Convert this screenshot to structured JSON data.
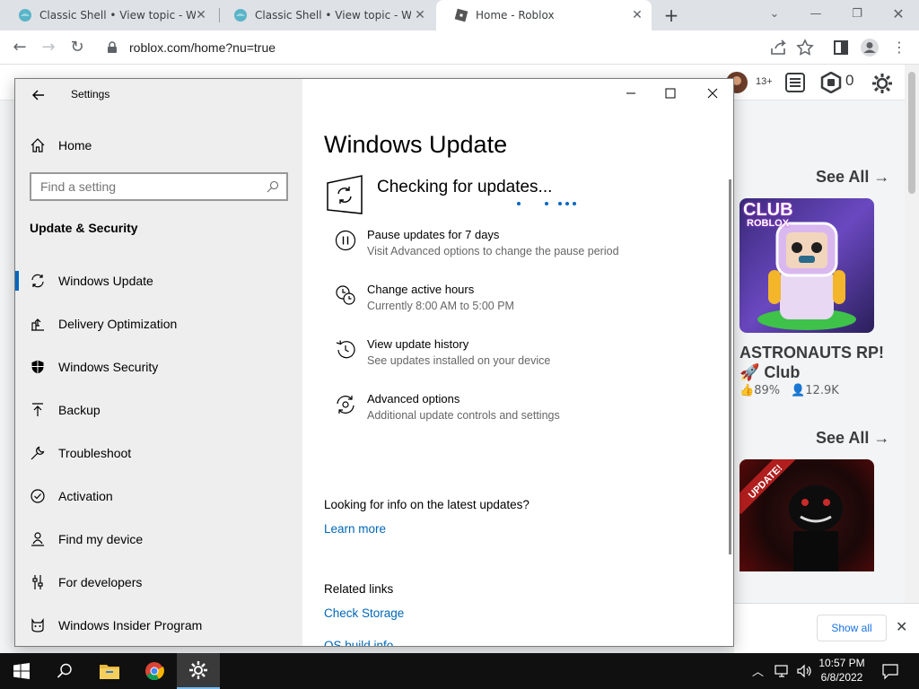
{
  "browser": {
    "tabs": [
      {
        "title": "Classic Shell • View topic - Windo",
        "active": false
      },
      {
        "title": "Classic Shell • View topic - Windo",
        "active": false
      },
      {
        "title": "Home - Roblox",
        "active": true
      }
    ],
    "url": "roblox.com/home?nu=true",
    "accent": "#1a73e8"
  },
  "roblox": {
    "notification_badge": "13+",
    "robux_count": "0",
    "see_all_1": "See All →",
    "see_all_2": "See All →",
    "game_title": "ASTRONAUTS RP! 🚀 Club",
    "game_like": "89%",
    "game_players": "12.9K",
    "thumb1_text_top": "CLUB",
    "thumb1_text_bottom": "ROBLOX",
    "thumb2_badge": "UPDATE!"
  },
  "downloads": {
    "show_all": "Show all"
  },
  "settings": {
    "window_title": "Settings",
    "home": "Home",
    "search_placeholder": "Find a setting",
    "section": "Update & Security",
    "nav": [
      {
        "label": "Windows Update",
        "icon": "sync-icon",
        "selected": true
      },
      {
        "label": "Delivery Optimization",
        "icon": "delivery-icon",
        "selected": false
      },
      {
        "label": "Windows Security",
        "icon": "shield-icon",
        "selected": false
      },
      {
        "label": "Backup",
        "icon": "backup-arrow-icon",
        "selected": false
      },
      {
        "label": "Troubleshoot",
        "icon": "wrench-icon",
        "selected": false
      },
      {
        "label": "Activation",
        "icon": "check-circle-icon",
        "selected": false
      },
      {
        "label": "Find my device",
        "icon": "person-pin-icon",
        "selected": false
      },
      {
        "label": "For developers",
        "icon": "developer-sliders-icon",
        "selected": false
      },
      {
        "label": "Windows Insider Program",
        "icon": "insider-cat-icon",
        "selected": false
      }
    ],
    "page_title": "Windows Update",
    "status": "Checking for updates...",
    "options": [
      {
        "title": "Pause updates for 7 days",
        "subtitle": "Visit Advanced options to change the pause period",
        "icon": "pause-icon"
      },
      {
        "title": "Change active hours",
        "subtitle": "Currently 8:00 AM to 5:00 PM",
        "icon": "active-hours-icon"
      },
      {
        "title": "View update history",
        "subtitle": "See updates installed on your device",
        "icon": "history-icon"
      },
      {
        "title": "Advanced options",
        "subtitle": "Additional update controls and settings",
        "icon": "advanced-sync-icon"
      }
    ],
    "info_heading": "Looking for info on the latest updates?",
    "learn_more": "Learn more",
    "related_heading": "Related links",
    "check_storage": "Check Storage",
    "os_build_partial": "OS build info",
    "accent": "#0067c0"
  },
  "taskbar": {
    "time": "10:57 PM",
    "date": "6/8/2022"
  }
}
